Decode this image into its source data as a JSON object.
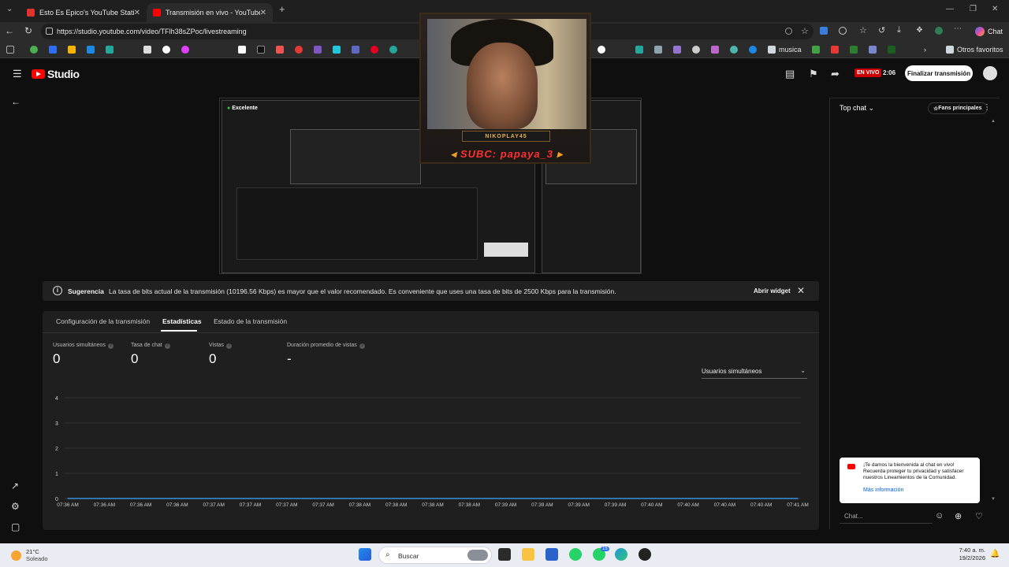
{
  "browser": {
    "tabs": [
      {
        "title": "Esto Es Epico's YouTube Statistics",
        "active": false,
        "favicon_color": "#e0322f"
      },
      {
        "title": "Transmisión en vivo - YouTube Stu",
        "active": true,
        "favicon_color": "#ff0000"
      }
    ],
    "new_tab_symbol": "+",
    "url": "https://studio.youtube.com/video/TFlh38sZPoc/livestreaming",
    "chat_button": "Chat",
    "bookmarks": {
      "musica": "musica",
      "otros": "Otros favoritos"
    }
  },
  "studio": {
    "logo_text": "Studio",
    "live_badge": "EN VIVO",
    "live_time": "2:06",
    "end_button": "Finalizar transmisión"
  },
  "preview": {
    "status": "Excelente",
    "overlay_name": "NIKOPLAY45",
    "overlay_sub": "SUBC: papaya_3"
  },
  "suggestion": {
    "title": "Sugerencia",
    "text": "La tasa de bits actual de la transmisión (10196.56 Kbps) es mayor que el valor recomendado. Es conveniente que uses una tasa de bits de 2500 Kbps para la transmisión.",
    "button": "Abrir widget"
  },
  "panel": {
    "tabs": [
      "Configuración de la transmisión",
      "Estadísticas",
      "Estado de la transmisión"
    ],
    "active_tab": "Estadísticas",
    "metrics": [
      {
        "label": "Usuarios simultáneos",
        "value": "0"
      },
      {
        "label": "Tasa de chat",
        "value": "0"
      },
      {
        "label": "Vistas",
        "value": "0"
      },
      {
        "label": "Duración promedio de vistas",
        "value": "-"
      }
    ],
    "dropdown": "Usuarios simultáneos"
  },
  "chart_data": {
    "type": "line",
    "title": "",
    "xlabel": "",
    "ylabel": "",
    "ylim": [
      0,
      4
    ],
    "y_ticks": [
      "4",
      "3",
      "2",
      "1",
      "0"
    ],
    "x": [
      "07:36 AM",
      "07:36 AM",
      "07:36 AM",
      "07:36 AM",
      "07:37 AM",
      "07:37 AM",
      "07:37 AM",
      "07:37 AM",
      "07:38 AM",
      "07:38 AM",
      "07:38 AM",
      "07:38 AM",
      "07:39 AM",
      "07:39 AM",
      "07:39 AM",
      "07:39 AM",
      "07:40 AM",
      "07:40 AM",
      "07:40 AM",
      "07:40 AM",
      "07:41 AM"
    ],
    "series": [
      {
        "values": [
          0,
          0,
          0,
          0,
          0,
          0,
          0,
          0,
          0,
          0,
          0,
          0,
          0,
          0,
          0,
          0,
          0,
          0,
          0,
          0,
          0
        ],
        "color": "#3ea6ff"
      }
    ],
    "grid": true
  },
  "chat": {
    "header": "Top chat",
    "fans_button": "Fans principales",
    "welcome": "¡Te damos la bienvenida al chat en vivo! Recuerda proteger tu privacidad y satisfacer nuestros Lineamientos de la Comunidad.",
    "more_info": "Más información",
    "input_placeholder": "Chat..."
  },
  "taskbar": {
    "temp": "21°C",
    "weather": "Soleado",
    "search": "Buscar",
    "whatsapp_badge": "15",
    "time": "7:40 a. m.",
    "date": "19/2/2026"
  }
}
